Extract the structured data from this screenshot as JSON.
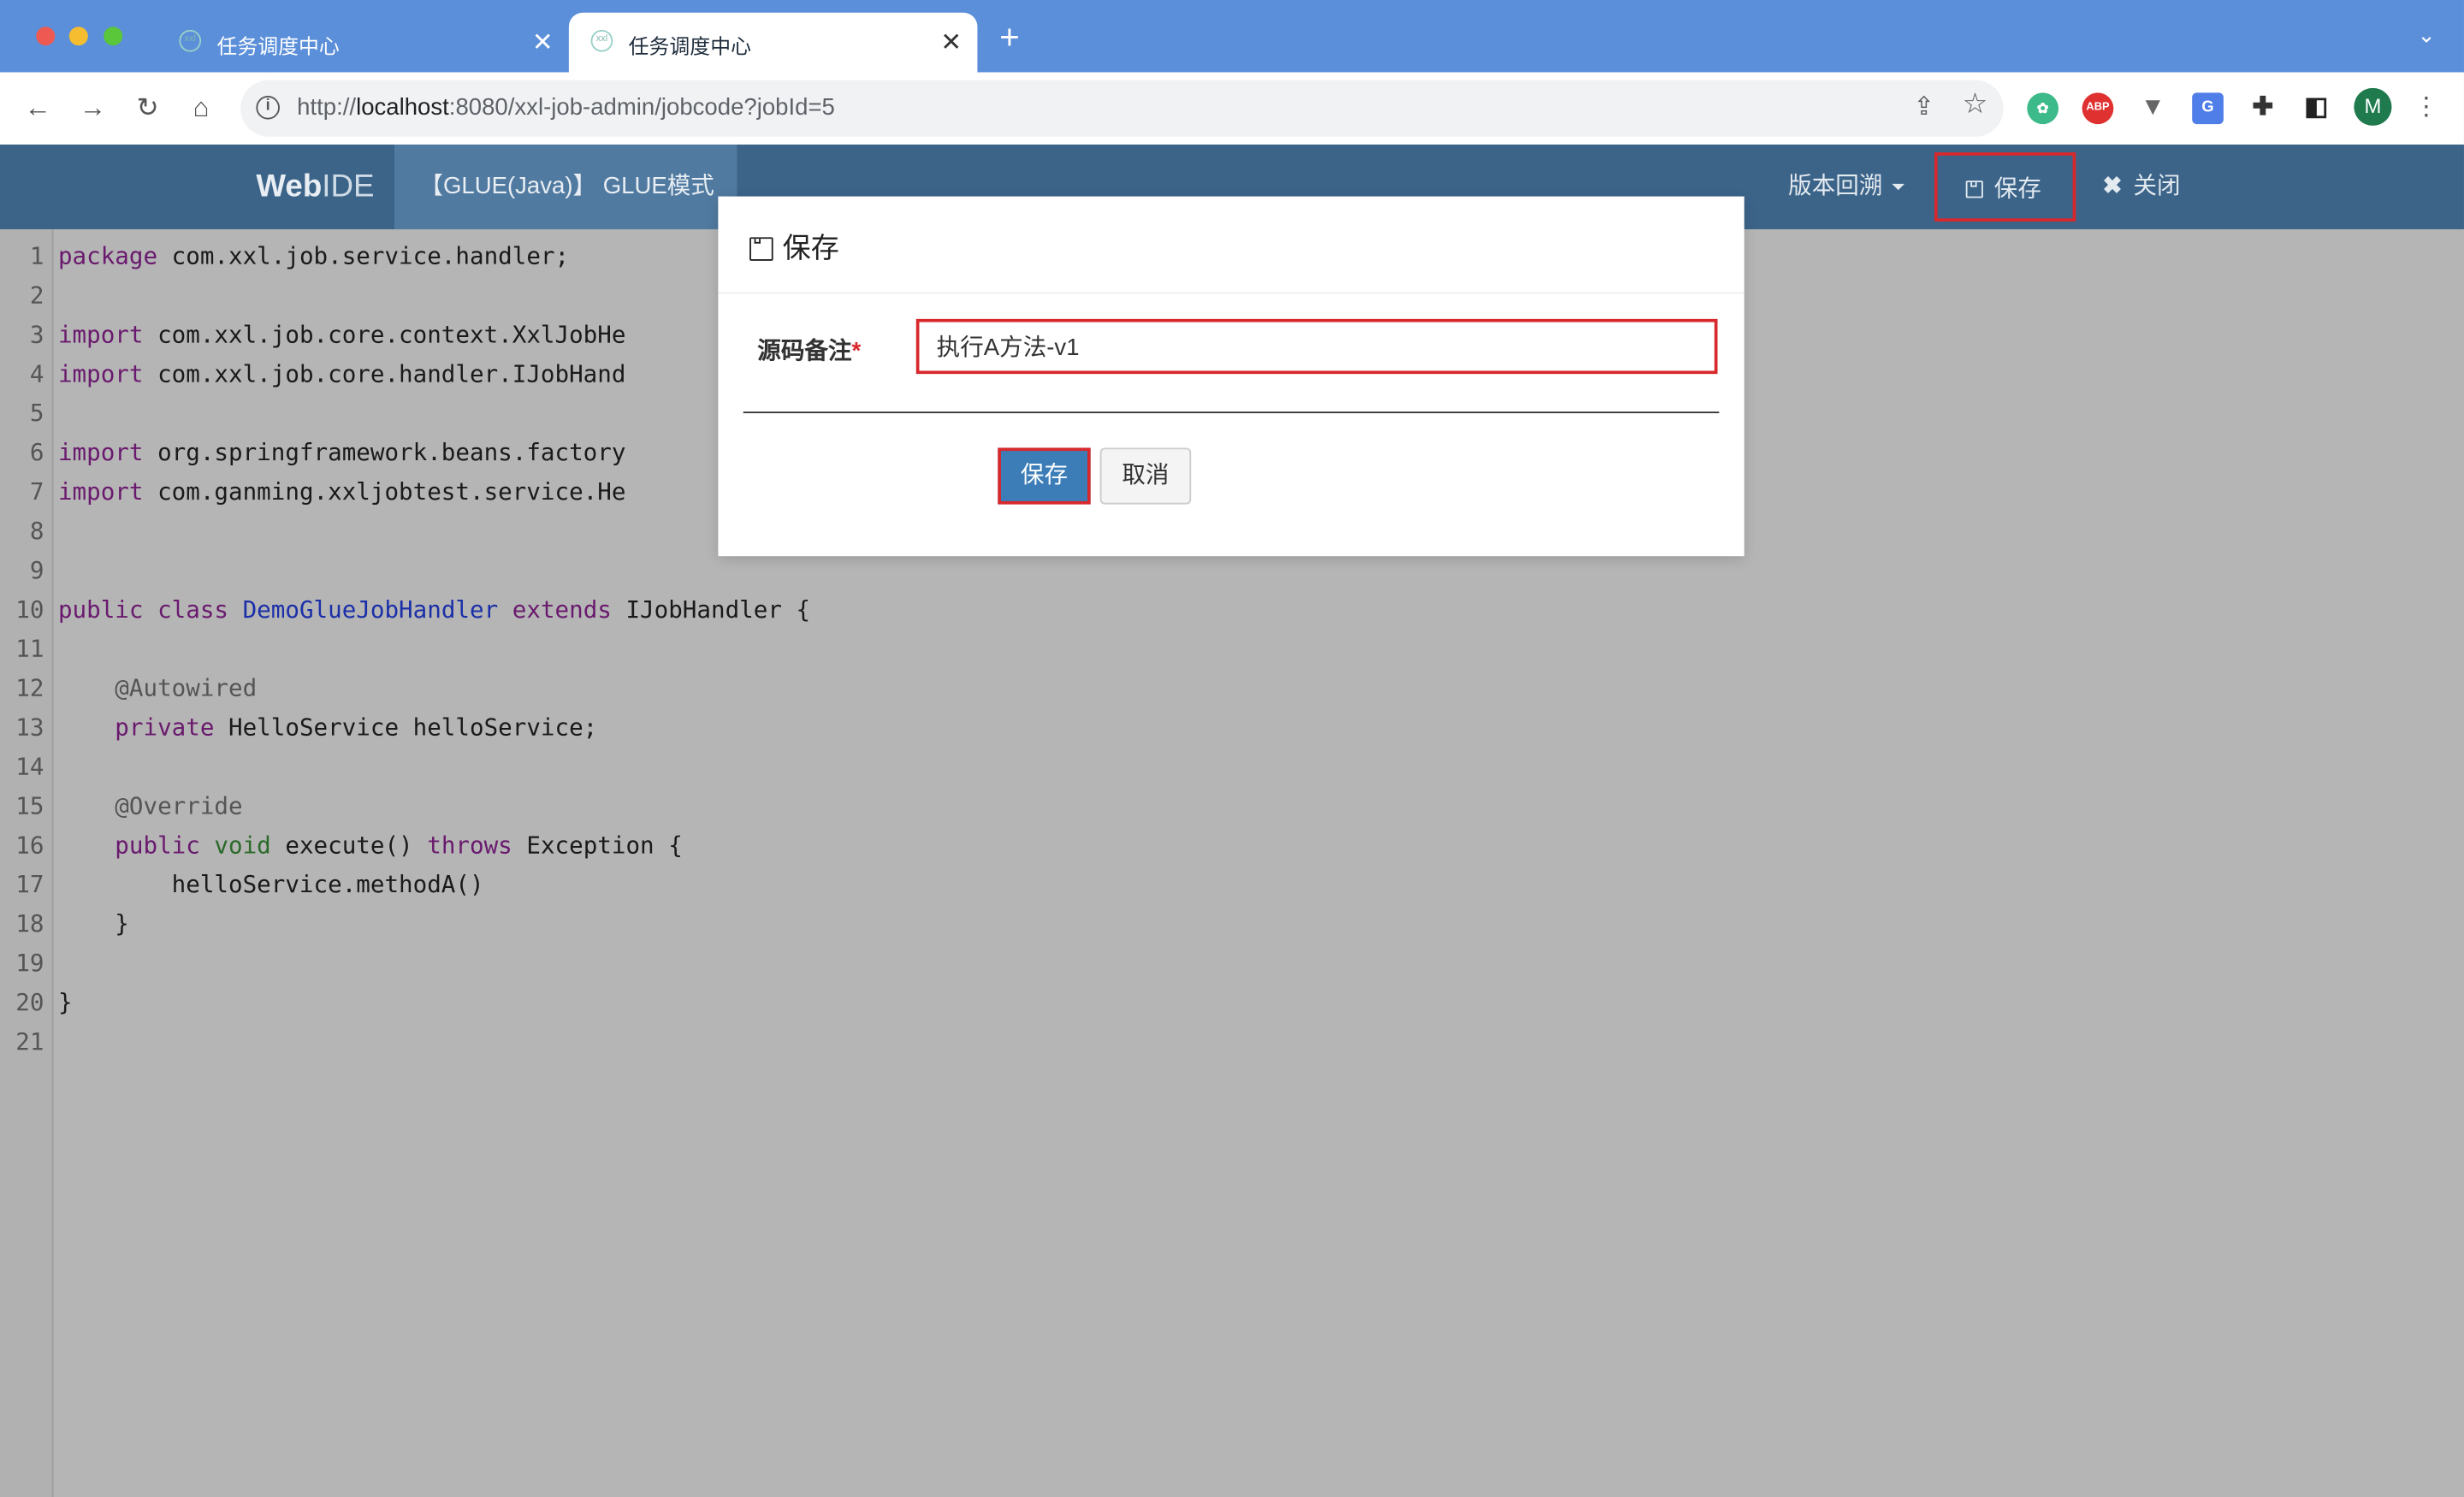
{
  "browser": {
    "tabs": [
      {
        "title": "任务调度中心",
        "active": false
      },
      {
        "title": "任务调度中心",
        "active": true
      }
    ],
    "new_tab_glyph": "+",
    "url_prefix": "http://",
    "url_host": "localhost",
    "url_rest": ":8080/xxl-job-admin/jobcode?jobId=5",
    "profile_initial": "M",
    "extensions": [
      "chrome-ext-icon",
      "adblock-icon",
      "vue-devtools-icon",
      "translate-icon",
      "puzzle-icon",
      "sidepanel-icon"
    ]
  },
  "header": {
    "brand_bold": "Web",
    "brand_rest": "IDE",
    "glue_mode": "【GLUE(Java)】 GLUE模式",
    "version_label": "版本回溯",
    "save_label": "保存",
    "close_label": "关闭"
  },
  "editor": {
    "lines": [
      "1",
      "2",
      "3",
      "4",
      "5",
      "6",
      "7",
      "8",
      "9",
      "10",
      "11",
      "12",
      "13",
      "14",
      "15",
      "16",
      "17",
      "18",
      "19",
      "20",
      "21"
    ]
  },
  "modal": {
    "title": "保存",
    "field_label": "源码备注",
    "required_mark": "*",
    "remark_value": "执行A方法-v1",
    "save_button": "保存",
    "cancel_button": "取消"
  },
  "colors": {
    "tabbar": "#5b8fd9",
    "header": "#3c6489",
    "primary_button": "#3c7db8",
    "highlight": "#d8282b"
  }
}
